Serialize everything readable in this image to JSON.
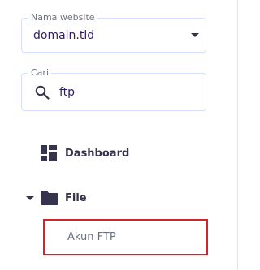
{
  "website_select": {
    "legend": "Nama website",
    "value": "domain.tld"
  },
  "search": {
    "legend": "Cari",
    "value": "ftp"
  },
  "nav": {
    "dashboard_label": "Dashboard",
    "file_label": "File",
    "file_children": [
      {
        "label": "Akun FTP",
        "highlighted": true
      }
    ]
  },
  "colors": {
    "text_primary": "#2f1c6a",
    "icon": "#36344d",
    "muted": "#6d7081",
    "field_border": "#d5dfff",
    "highlight_border": "#d4232a"
  },
  "icons": {
    "select_caret": "chevron-down-icon",
    "search": "search-icon",
    "dashboard": "dashboard-grid-icon",
    "expand": "caret-down-icon",
    "folder": "folder-icon"
  }
}
